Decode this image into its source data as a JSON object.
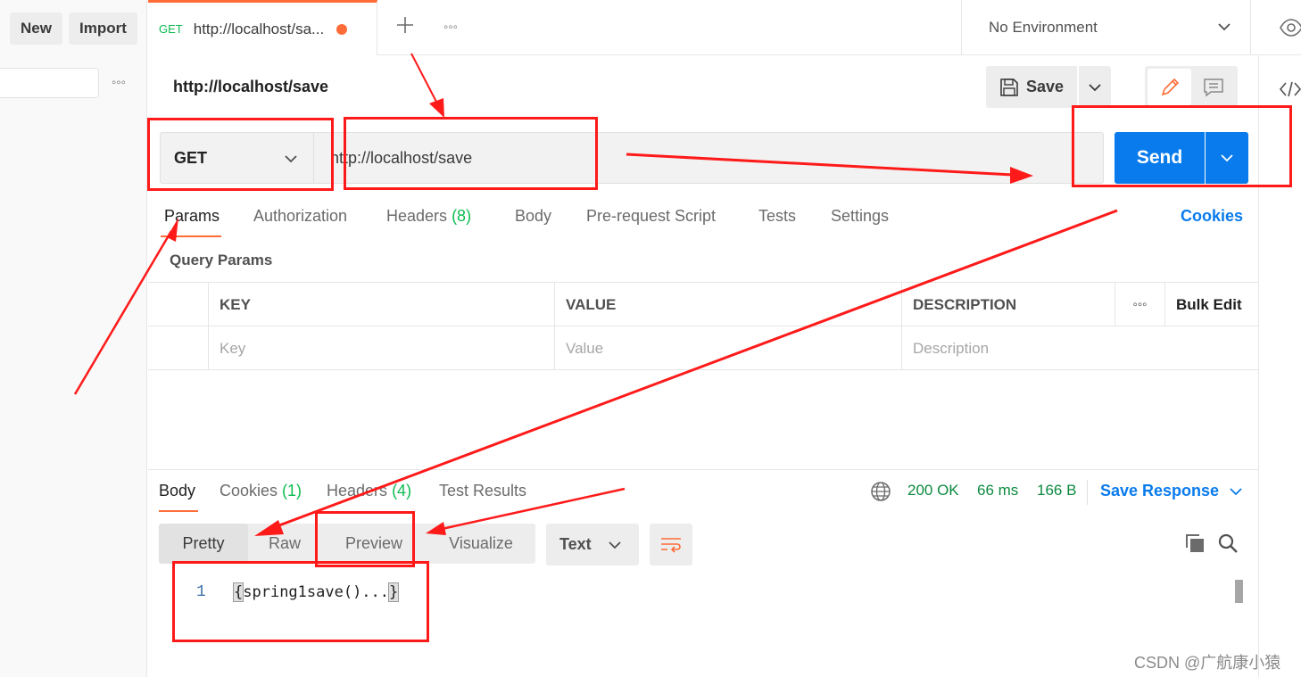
{
  "sidebar": {
    "new_label": "New",
    "import_label": "Import",
    "more_icon": "more-horizontal-icon"
  },
  "tabs": {
    "active": {
      "method": "GET",
      "title": "http://localhost/sa...",
      "unsaved": true
    },
    "add_icon": "plus-icon",
    "more_icon": "more-horizontal-icon",
    "environment": "No Environment",
    "eye_icon": "eye-icon"
  },
  "request": {
    "title": "http://localhost/save",
    "save_label": "Save",
    "method": "GET",
    "url": "http://localhost/save",
    "send_label": "Send",
    "tabs": [
      {
        "label": "Params"
      },
      {
        "label": "Authorization"
      },
      {
        "label": "Headers",
        "count": "(8)"
      },
      {
        "label": "Body"
      },
      {
        "label": "Pre-request Script"
      },
      {
        "label": "Tests"
      },
      {
        "label": "Settings"
      }
    ],
    "cookies_label": "Cookies",
    "query_params_title": "Query Params",
    "table": {
      "headers": [
        "KEY",
        "VALUE",
        "DESCRIPTION"
      ],
      "bulk_edit": "Bulk Edit",
      "placeholders": [
        "Key",
        "Value",
        "Description"
      ]
    }
  },
  "response": {
    "tabs": [
      {
        "label": "Body"
      },
      {
        "label": "Cookies",
        "count": "(1)"
      },
      {
        "label": "Headers",
        "count": "(4)"
      },
      {
        "label": "Test Results"
      }
    ],
    "status": "200 OK",
    "time": "66 ms",
    "size": "166 B",
    "save_response_label": "Save Response",
    "formats": [
      "Pretty",
      "Raw",
      "Preview",
      "Visualize"
    ],
    "language": "Text",
    "line_number": "1",
    "code": {
      "open": "{",
      "text": "spring1save()...",
      "close": "}"
    }
  },
  "colors": {
    "accent_orange": "#ff6c37",
    "primary_blue": "#097bed",
    "success_green": "#0cbb52",
    "annotation_red": "#ff1a1a"
  },
  "watermark": "CSDN @广航康小猿"
}
